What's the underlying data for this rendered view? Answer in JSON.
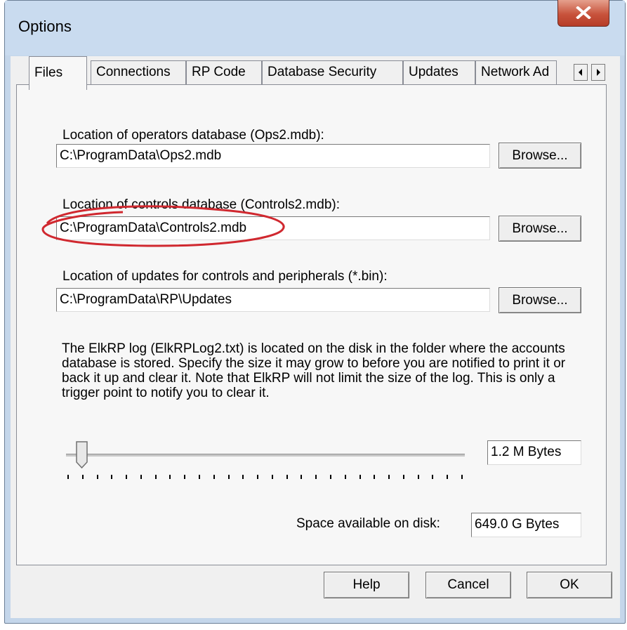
{
  "window": {
    "title": "Options"
  },
  "tabs": [
    "Files",
    "Connections",
    "RP Code",
    "Database Security",
    "Updates",
    "Network Ad"
  ],
  "files": {
    "ops_label": "Location of operators database (Ops2.mdb):",
    "ops_value": "C:\\ProgramData\\Ops2.mdb",
    "controls_label": "Location of controls database (Controls2.mdb):",
    "controls_value": "C:\\ProgramData\\Controls2.mdb",
    "updates_label": "Location of updates for controls and peripherals (*.bin):",
    "updates_value": "C:\\ProgramData\\RP\\Updates",
    "browse_label": "Browse...",
    "log_description": "The ElkRP log (ElkRPLog2.txt) is located on the disk in the folder where the accounts database is stored.  Specify the size it may grow to before you are notified to print it or back it up and clear it.  Note that ElkRP will not limit the size of the log.  This is only a trigger point to notify you to clear it.",
    "log_size_value": "1.2 M Bytes",
    "log_size_slider_fraction": 0.02,
    "space_label": "Space available on disk:",
    "space_value": "649.0 G Bytes"
  },
  "buttons": {
    "help": "Help",
    "cancel": "Cancel",
    "ok": "OK"
  },
  "colors": {
    "annotation_ellipse": "#d0282f",
    "close_button": "#c8533c"
  },
  "icons": {
    "close": "close-icon",
    "tab_scroll_left": "arrow-left-icon",
    "tab_scroll_right": "arrow-right-icon"
  }
}
